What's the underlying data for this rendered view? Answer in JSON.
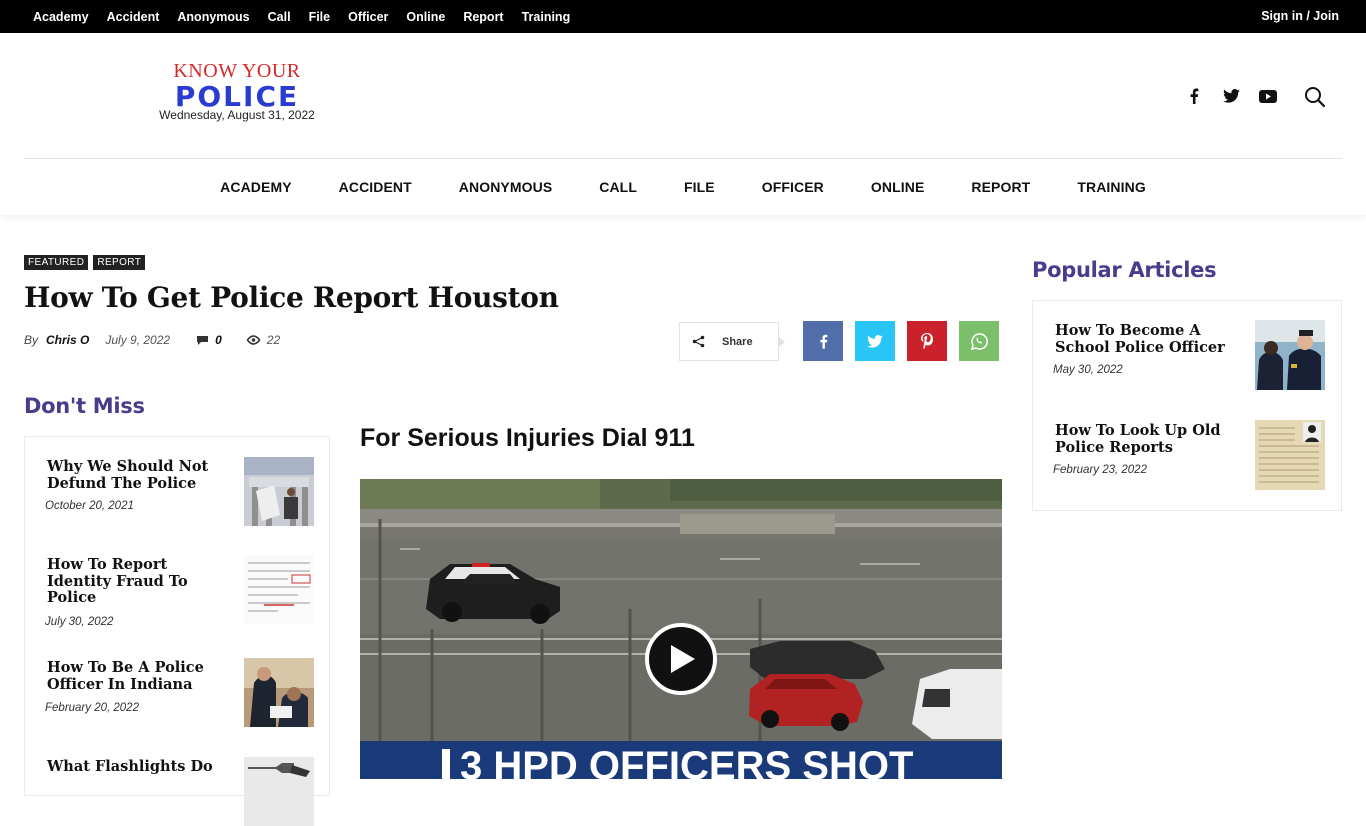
{
  "topbar": {
    "menu": [
      "Academy",
      "Accident",
      "Anonymous",
      "Call",
      "File",
      "Officer",
      "Online",
      "Report",
      "Training"
    ],
    "signin": "Sign in / Join"
  },
  "logo": {
    "line1": "KNOW YOUR",
    "line2": "POLICE",
    "date": "Wednesday, August 31, 2022"
  },
  "header_social": [
    "facebook-icon",
    "twitter-icon",
    "youtube-icon"
  ],
  "mainnav": [
    "ACADEMY",
    "ACCIDENT",
    "ANONYMOUS",
    "CALL",
    "FILE",
    "OFFICER",
    "ONLINE",
    "REPORT",
    "TRAINING"
  ],
  "article": {
    "categories": [
      "FEATURED",
      "REPORT"
    ],
    "title": "How To Get Police Report Houston",
    "by": "By",
    "author": "Chris O",
    "date": "July 9, 2022",
    "comments": "0",
    "views": "22",
    "share_label": "Share",
    "subheading": "For Serious Injuries Dial 911",
    "video_caption": "3 HPD OFFICERS SHOT"
  },
  "share_buttons": [
    {
      "icon": "facebook-icon",
      "color": "#516eab"
    },
    {
      "icon": "twitter-icon",
      "color": "#29c5f6"
    },
    {
      "icon": "pinterest-icon",
      "color": "#ca212a"
    },
    {
      "icon": "whatsapp-icon",
      "color": "#7bbf6a"
    }
  ],
  "dont_miss": {
    "title": "Don't Miss",
    "items": [
      {
        "title": "Why We Should Not Defund The Police",
        "date": "October 20, 2021"
      },
      {
        "title": "How To Report Identity Fraud To Police",
        "date": "July 30, 2022"
      },
      {
        "title": "How To Be A Police Officer In Indiana",
        "date": "February 20, 2022"
      },
      {
        "title": "What Flashlights Do",
        "date": ""
      }
    ]
  },
  "popular": {
    "title": "Popular Articles",
    "items": [
      {
        "title": "How To Become A School Police Officer",
        "date": "May 30, 2022"
      },
      {
        "title": "How To Look Up Old Police Reports",
        "date": "February 23, 2022"
      }
    ]
  },
  "colors": {
    "accent_purple": "#4a3c8c",
    "logo_red": "#d62828",
    "logo_blue": "#2a3bd1"
  }
}
